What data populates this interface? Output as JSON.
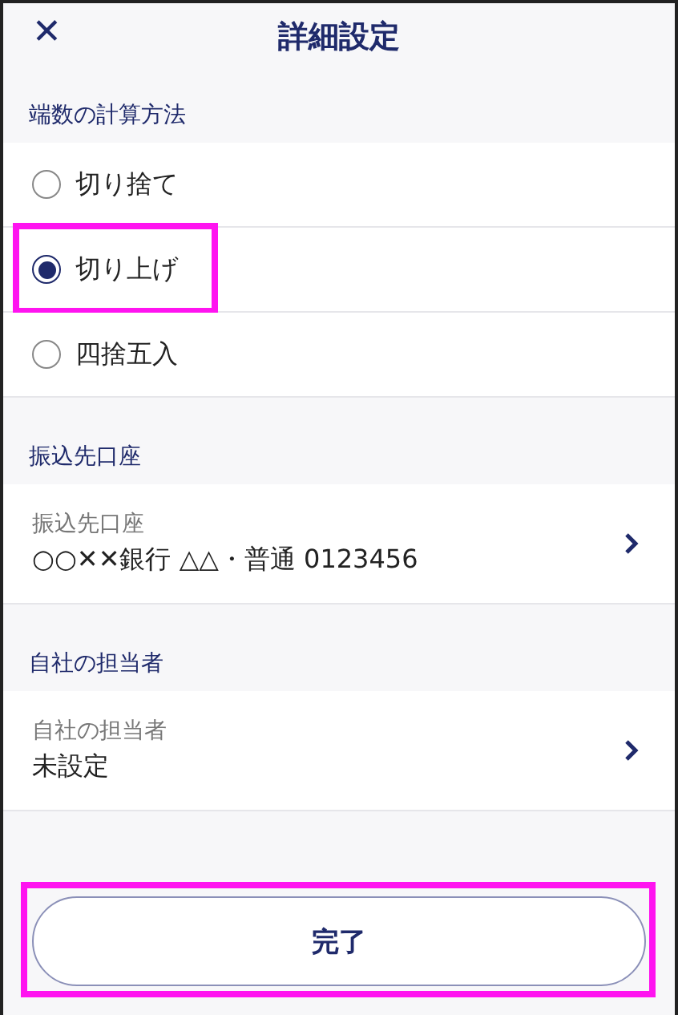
{
  "header": {
    "title": "詳細設定",
    "close_icon": "✕"
  },
  "rounding": {
    "heading": "端数の計算方法",
    "options": [
      {
        "label": "切り捨て",
        "selected": false,
        "highlighted": false
      },
      {
        "label": "切り上げ",
        "selected": true,
        "highlighted": true
      },
      {
        "label": "四捨五入",
        "selected": false,
        "highlighted": false
      }
    ]
  },
  "sections": [
    {
      "heading": "振込先口座",
      "label": "振込先口座",
      "value": "○○✕✕銀行 △△・普通 0123456"
    },
    {
      "heading": "自社の担当者",
      "label": "自社の担当者",
      "value": "未設定"
    }
  ],
  "done_button": {
    "label": "完了",
    "highlighted": true
  }
}
